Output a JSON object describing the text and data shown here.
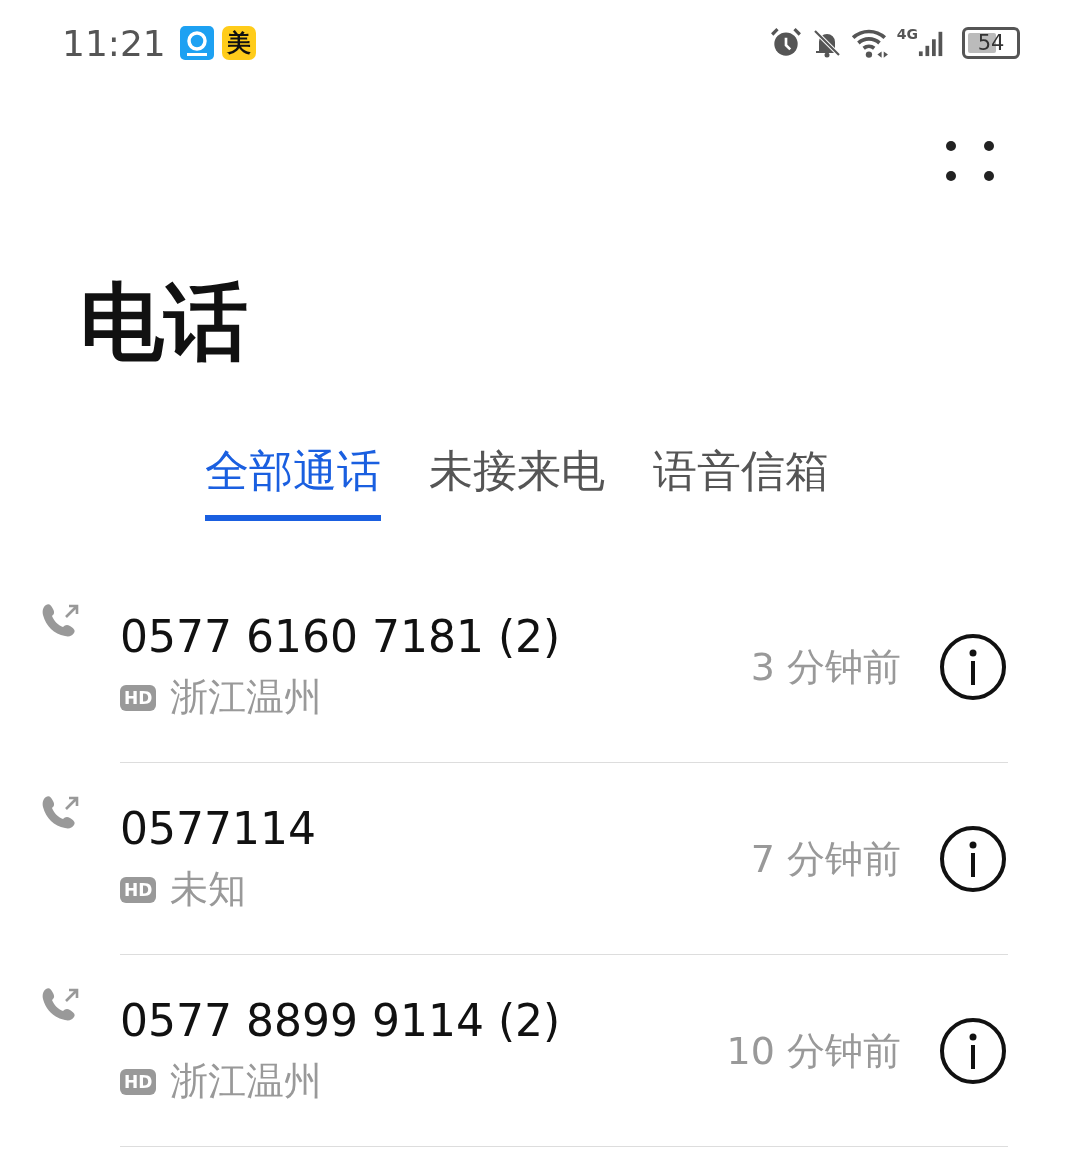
{
  "status_bar": {
    "time": "11:21",
    "app_badge": "美",
    "network": "4G",
    "battery": "54"
  },
  "title": "电话",
  "tabs": [
    {
      "label": "全部通话",
      "selected": true
    },
    {
      "label": "未接来电",
      "selected": false
    },
    {
      "label": "语音信箱",
      "selected": false
    }
  ],
  "calls": [
    {
      "number": "0577 6160 7181 (2)",
      "hd": "HD",
      "location": "浙江温州",
      "time": "3 分钟前"
    },
    {
      "number": "0577114",
      "hd": "HD",
      "location": "未知",
      "time": "7 分钟前"
    },
    {
      "number": "0577 8899 9114 (2)",
      "hd": "HD",
      "location": "浙江温州",
      "time": "10 分钟前"
    }
  ]
}
